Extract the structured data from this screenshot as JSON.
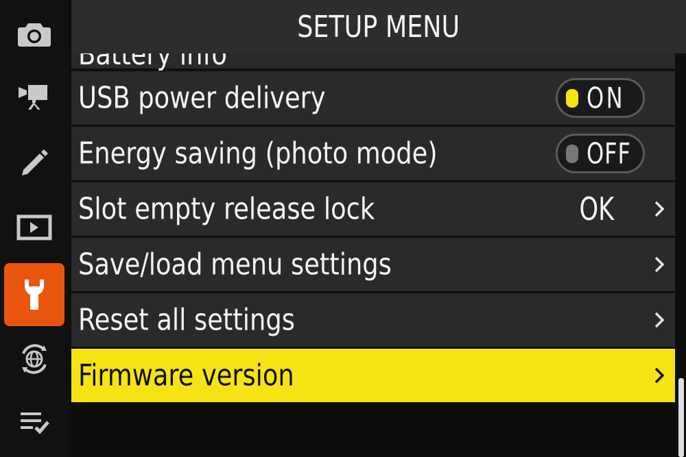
{
  "header": {
    "title": "SETUP MENU"
  },
  "tabs": [
    {
      "name": "photo-shooting-menu-tab",
      "icon": "camera-icon",
      "active": false
    },
    {
      "name": "video-recording-menu-tab",
      "icon": "movie-camera-icon",
      "active": false
    },
    {
      "name": "custom-settings-menu-tab",
      "icon": "pencil-icon",
      "active": false
    },
    {
      "name": "playback-menu-tab",
      "icon": "playback-icon",
      "active": false
    },
    {
      "name": "setup-menu-tab",
      "icon": "wrench-icon",
      "active": true
    },
    {
      "name": "network-menu-tab",
      "icon": "globe-network-icon",
      "active": false
    },
    {
      "name": "my-menu-tab",
      "icon": "checklist-icon",
      "active": false
    }
  ],
  "menu": {
    "items": [
      {
        "label": "Battery info",
        "partial": true
      },
      {
        "label": "USB power delivery",
        "toggle": "ON"
      },
      {
        "label": "Energy saving (photo mode)",
        "toggle": "OFF"
      },
      {
        "label": "Slot empty release lock",
        "value": "OK",
        "chevron": true
      },
      {
        "label": "Save/load menu settings",
        "chevron": true
      },
      {
        "label": "Reset all settings",
        "chevron": true
      },
      {
        "label": "Firmware version",
        "chevron": true,
        "selected": true
      }
    ]
  },
  "colors": {
    "accent_tab": "#e8560e",
    "selected_row": "#f5e414",
    "toggle_on_knob": "#f5e414",
    "toggle_off_knob": "#777777"
  },
  "scroll": {
    "position_fraction": 1.0
  }
}
